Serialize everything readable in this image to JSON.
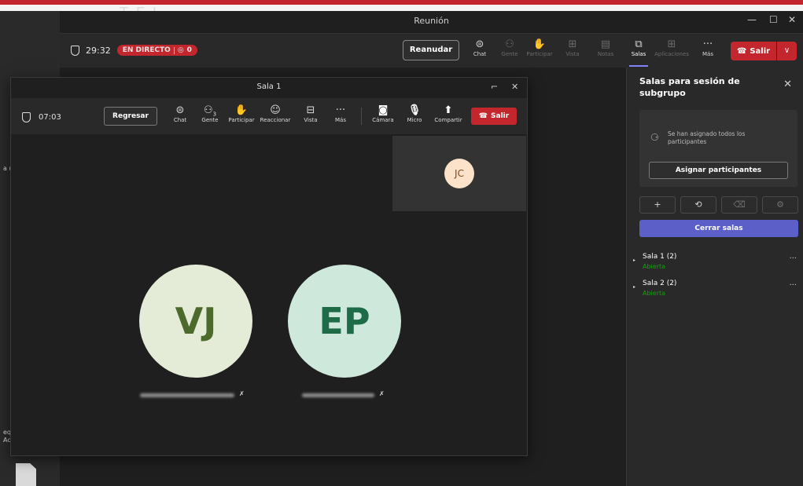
{
  "desktop": {
    "title_fragment": "T E I",
    "left_fragments": [
      "a (",
      "eq",
      "Ac"
    ]
  },
  "main_window": {
    "title": "Reunión",
    "controls": {
      "minimize": "—",
      "maximize": "☐",
      "close": "✕"
    },
    "toolbar": {
      "timer": "29:32",
      "live_label": "EN DIRECTO",
      "live_count": "0",
      "resume_label": "Reanudar",
      "tools": [
        {
          "label": "Chat",
          "icon": "chat-icon",
          "glyph": "⊜",
          "state": "normal"
        },
        {
          "label": "Gente",
          "icon": "people-icon",
          "glyph": "⚇",
          "state": "dim"
        },
        {
          "label": "Participar",
          "icon": "raise-hand-icon",
          "glyph": "✋",
          "state": "dim"
        },
        {
          "label": "Vista",
          "icon": "view-icon",
          "glyph": "⊞",
          "state": "dim"
        },
        {
          "label": "Notas",
          "icon": "notes-icon",
          "glyph": "▤",
          "state": "dim"
        },
        {
          "label": "Salas",
          "icon": "rooms-icon",
          "glyph": "⧉",
          "state": "active"
        },
        {
          "label": "Aplicaciones",
          "icon": "apps-icon",
          "glyph": "⊞",
          "state": "dim"
        },
        {
          "label": "Más",
          "icon": "more-icon",
          "glyph": "···",
          "state": "normal"
        }
      ],
      "leave_label": "Salir"
    }
  },
  "breakout_panel": {
    "title": "Salas para sesión de subgrupo",
    "assigned_message": "Se han asignado todos los participantes",
    "assign_button": "Asignar participantes",
    "icon_buttons": [
      {
        "name": "add-room-button",
        "icon": "plus-icon",
        "glyph": "+"
      },
      {
        "name": "reassign-button",
        "icon": "reassign-icon",
        "glyph": "⟲"
      },
      {
        "name": "delete-room-button",
        "icon": "trash-icon",
        "glyph": "🗑"
      },
      {
        "name": "room-settings-button",
        "icon": "gear-icon",
        "glyph": "⚙"
      }
    ],
    "close_rooms_button": "Cerrar salas",
    "rooms": [
      {
        "name": "Sala 1 (2)",
        "status": "Abierta"
      },
      {
        "name": "Sala 2 (2)",
        "status": "Abierta"
      }
    ]
  },
  "sala_window": {
    "title": "Sala 1",
    "controls": {
      "popout": "⌐",
      "close": "✕"
    },
    "toolbar": {
      "timer": "07:03",
      "back_label": "Regresar",
      "people_count": "3",
      "tools": [
        {
          "label": "Chat",
          "icon": "chat-icon",
          "glyph": "⊜"
        },
        {
          "label": "Gente",
          "icon": "people-icon",
          "glyph": "⚇"
        },
        {
          "label": "Participar",
          "icon": "raise-hand-icon",
          "glyph": "✋"
        },
        {
          "label": "Reaccionar",
          "icon": "reaction-icon",
          "glyph": "☺"
        },
        {
          "label": "Vista",
          "icon": "view-icon",
          "glyph": "⊟"
        },
        {
          "label": "Más",
          "icon": "more-icon",
          "glyph": "···"
        },
        {
          "label": "Cámara",
          "icon": "camera-off-icon",
          "glyph": "◙"
        },
        {
          "label": "Micro",
          "icon": "mic-off-icon",
          "glyph": "🎙"
        },
        {
          "label": "Compartir",
          "icon": "share-icon",
          "glyph": "⬆"
        }
      ],
      "leave_label": "Salir"
    },
    "participants": [
      {
        "initials": "JC"
      },
      {
        "initials": "VJ"
      },
      {
        "initials": "EP"
      }
    ]
  },
  "colors": {
    "leave_red": "#c4262e",
    "accent_purple": "#5b5fc7",
    "open_green": "#13a10e",
    "background": "#1f1f1f"
  }
}
